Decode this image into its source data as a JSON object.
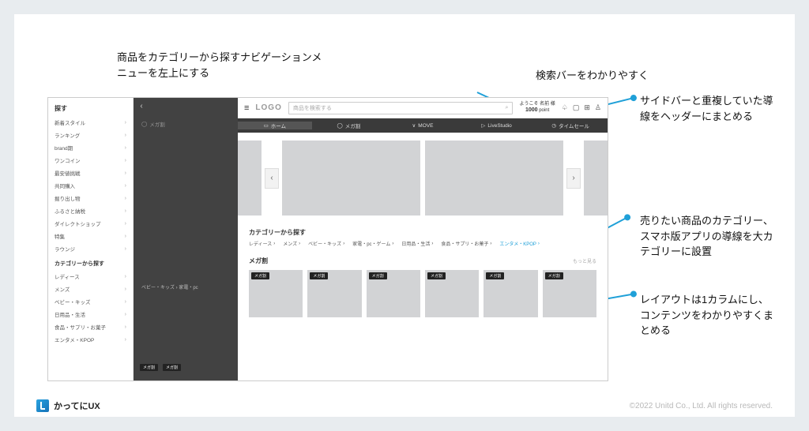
{
  "annotations": {
    "topLeft": "商品をカテゴリーから探すナビゲーションメニューを左上にする",
    "searchBar": "検索バーをわかりやすく",
    "headerDup": "サイドバーと重複していた導線をヘッダーにまとめる",
    "bigCat": "売りたい商品のカテゴリー、スマホ版アプリの導線を大カテゴリーに設置",
    "layout1col": "レイアウトは1カラムにし、コンテンツをわかりやすくまとめる"
  },
  "header": {
    "logo": "LOGO",
    "searchPlaceholder": "商品を検索する",
    "welcomePrefix": "ようこそ 名前 様",
    "points": "1000",
    "pointsUnit": "point"
  },
  "tabs": [
    {
      "icon": "home-icon",
      "label": "ホーム",
      "active": true
    },
    {
      "icon": "tag-icon",
      "label": "メガ割"
    },
    {
      "icon": "chevrons-icon",
      "label": "MOVE"
    },
    {
      "icon": "play-icon",
      "label": "LiveStudio"
    },
    {
      "icon": "clock-icon",
      "label": "タイムセール"
    }
  ],
  "sidebar": {
    "title": "探す",
    "items": [
      "新着スタイル",
      "ランキング",
      "brand期",
      "ワンコイン",
      "最安値挑戦",
      "共同購入",
      "掘り出し物",
      "ふるさと納税",
      "ダイレクトショップ",
      "特集",
      "ラウンジ"
    ],
    "catTitle": "カテゴリーから探す",
    "cats": [
      "レディース",
      "メンズ",
      "ベビー・キッズ",
      "日用品・生活",
      "食品・サプリ・お菓子",
      "エンタメ・KPOP"
    ]
  },
  "ghost": {
    "tab": "メガ割",
    "cat": "ベビー・キッズ  ›    家電・pc",
    "chips": [
      "メガ割",
      "メガ割"
    ]
  },
  "categorySection": {
    "title": "カテゴリーから探す",
    "items": [
      "レディース",
      "メンズ",
      "ベビー・キッズ",
      "家電・pc・ゲーム",
      "日用品・生活",
      "食品・サプリ・お菓子",
      "エンタメ・KPOP"
    ]
  },
  "megaSection": {
    "title": "メガ割",
    "more": "もっと見る",
    "badge": "メガ割",
    "count": 6
  },
  "footer": {
    "brand": "かってにUX",
    "copyright": "©2022 Unitd Co., Ltd. All rights reserved."
  }
}
